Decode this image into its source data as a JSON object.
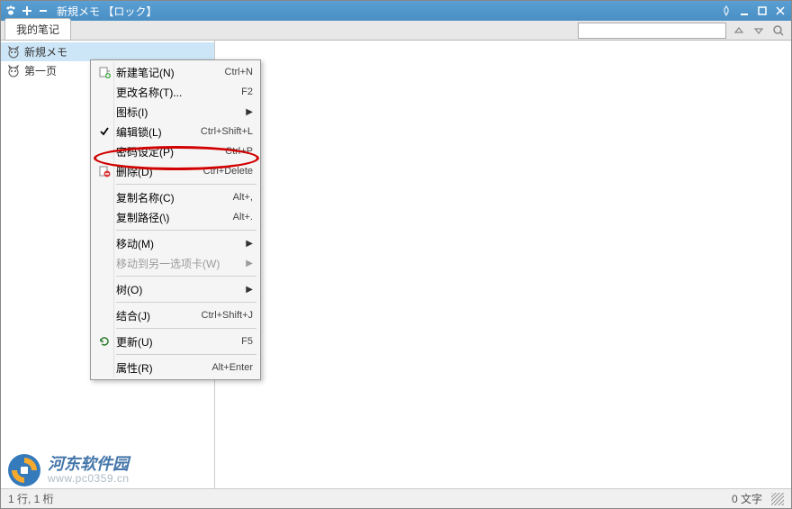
{
  "window": {
    "title": "新規メモ 【ロック】"
  },
  "tabs": [
    {
      "label": "我的笔记"
    }
  ],
  "sidebar": {
    "items": [
      {
        "label": "新規メモ",
        "selected": true
      },
      {
        "label": "第一页",
        "selected": false
      }
    ]
  },
  "context_menu": {
    "groups": [
      [
        {
          "icon": "new-note",
          "label": "新建笔记(N)",
          "shortcut": "Ctrl+N"
        },
        {
          "icon": "",
          "label": "更改名称(T)...",
          "shortcut": "F2"
        },
        {
          "icon": "",
          "label": "图标(I)",
          "submenu": true
        },
        {
          "icon": "check",
          "label": "编辑锁(L)",
          "shortcut": "Ctrl+Shift+L"
        },
        {
          "icon": "",
          "label": "密码设定(P)",
          "shortcut": "Ctrl+P",
          "highlighted": true
        },
        {
          "icon": "delete",
          "label": "删除(D)",
          "shortcut": "Ctrl+Delete"
        }
      ],
      [
        {
          "icon": "",
          "label": "复制名称(C)",
          "shortcut": "Alt+,"
        },
        {
          "icon": "",
          "label": "复制路径(\\)",
          "shortcut": "Alt+."
        }
      ],
      [
        {
          "icon": "",
          "label": "移动(M)",
          "submenu": true
        },
        {
          "icon": "",
          "label": "移动到另一选项卡(W)",
          "submenu": true,
          "disabled": true
        }
      ],
      [
        {
          "icon": "",
          "label": "树(O)",
          "submenu": true
        }
      ],
      [
        {
          "icon": "",
          "label": "结合(J)",
          "shortcut": "Ctrl+Shift+J"
        }
      ],
      [
        {
          "icon": "refresh",
          "label": "更新(U)",
          "shortcut": "F5"
        }
      ],
      [
        {
          "icon": "",
          "label": "属性(R)",
          "shortcut": "Alt+Enter"
        }
      ]
    ]
  },
  "statusbar": {
    "left": "1 行, 1 桁",
    "right": "0 文字"
  },
  "watermark": {
    "cn": "河东软件园",
    "url": "www.pc0359.cn"
  }
}
